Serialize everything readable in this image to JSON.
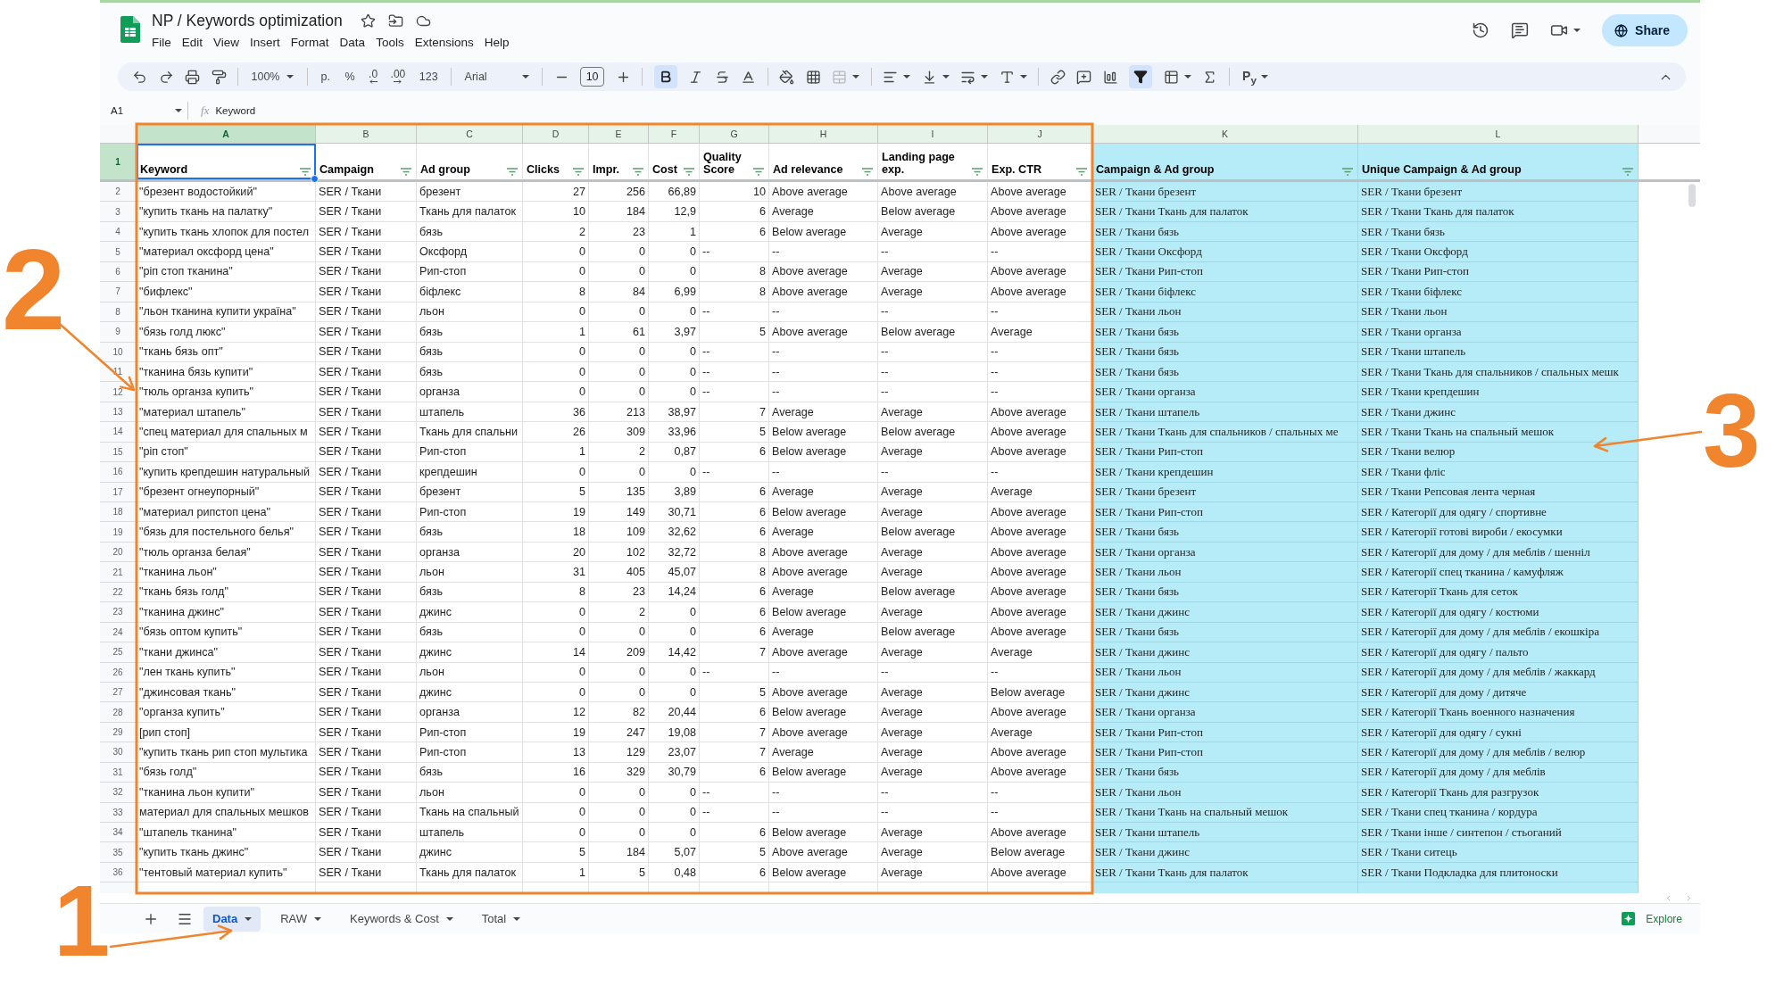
{
  "document": {
    "title": "NP / Keywords optimization",
    "menu": [
      "File",
      "Edit",
      "View",
      "Insert",
      "Format",
      "Data",
      "Tools",
      "Extensions",
      "Help"
    ],
    "share": "Share"
  },
  "toolbar": {
    "zoom": "100%",
    "currency": "р.",
    "percent": "%",
    "decimals_less": ".0",
    "decimals_more": ".00",
    "number_format": "123",
    "font": "Arial",
    "font_size": "10",
    "bold_on": true,
    "merge_disabled": true,
    "filter_on": true,
    "input_tools": "P$_{y}$"
  },
  "formula_bar": {
    "cell": "A1",
    "fx": "fx",
    "content": "Keyword"
  },
  "columns": [
    {
      "letter": "A",
      "header": "Keyword",
      "selected": true,
      "highlighted": false
    },
    {
      "letter": "B",
      "header": "Campaign",
      "selected": false,
      "highlighted": false
    },
    {
      "letter": "C",
      "header": "Ad group",
      "selected": false,
      "highlighted": false
    },
    {
      "letter": "D",
      "header": "Clicks",
      "selected": false,
      "highlighted": false
    },
    {
      "letter": "E",
      "header": "Impr.",
      "selected": false,
      "highlighted": false
    },
    {
      "letter": "F",
      "header": "Cost",
      "selected": false,
      "highlighted": false
    },
    {
      "letter": "G",
      "header": "Quality Score",
      "selected": false,
      "highlighted": false
    },
    {
      "letter": "H",
      "header": "Ad relevance",
      "selected": false,
      "highlighted": false
    },
    {
      "letter": "I",
      "header": "Landing page exp.",
      "selected": false,
      "highlighted": false
    },
    {
      "letter": "J",
      "header": "Exp. CTR",
      "selected": false,
      "highlighted": false
    },
    {
      "letter": "K",
      "header": "Campaign & Ad group",
      "selected": false,
      "highlighted": true
    },
    {
      "letter": "L",
      "header": "Unique Campaign & Ad group",
      "selected": false,
      "highlighted": true
    }
  ],
  "header_row": {
    "number": "1",
    "selected": true
  },
  "rows": [
    {
      "number": "2",
      "cells": [
        "\"брезент водостойкий\"",
        "SER / Ткани",
        "брезент",
        "27",
        "256",
        "66,89",
        "10",
        "Above average",
        "Above average",
        "Above average",
        "SER / Ткани брезент",
        "SER / Ткани брезент"
      ]
    },
    {
      "number": "3",
      "cells": [
        "\"купить ткань на палатку\"",
        "SER / Ткани",
        "Ткань для палаток",
        "10",
        "184",
        "12,9",
        "6",
        "Average",
        "Below average",
        "Above average",
        "SER / Ткани Ткань для палаток",
        "SER / Ткани Ткань для палаток"
      ]
    },
    {
      "number": "4",
      "cells": [
        "\"купить ткань хлопок для постел",
        "SER / Ткани",
        "бязь",
        "2",
        "23",
        "1",
        "6",
        "Below average",
        "Average",
        "Above average",
        "SER / Ткани бязь",
        "SER / Ткани бязь"
      ]
    },
    {
      "number": "5",
      "cells": [
        "\"материал оксфорд цена\"",
        "SER / Ткани",
        "Оксфорд",
        "0",
        "0",
        "0",
        "--",
        "--",
        "--",
        "--",
        "SER / Ткани Оксфорд",
        "SER / Ткани Оксфорд"
      ]
    },
    {
      "number": "6",
      "cells": [
        "\"ріп стоп тканина\"",
        "SER / Ткани",
        "Рип-стоп",
        "0",
        "0",
        "0",
        "8",
        "Above average",
        "Average",
        "Above average",
        "SER / Ткани Рип-стоп",
        "SER / Ткани Рип-стоп"
      ]
    },
    {
      "number": "7",
      "cells": [
        "\"бифлекс\"",
        "SER / Ткани",
        "біфлекс",
        "8",
        "84",
        "6,99",
        "8",
        "Above average",
        "Average",
        "Above average",
        "SER / Ткани біфлекс",
        "SER / Ткани біфлекс"
      ]
    },
    {
      "number": "8",
      "cells": [
        "\"льон тканина купити україна\"",
        "SER / Ткани",
        "льон",
        "0",
        "0",
        "0",
        "--",
        "--",
        "--",
        "--",
        "SER / Ткани льон",
        "SER / Ткани льон"
      ]
    },
    {
      "number": "9",
      "cells": [
        "\"бязь голд люкс\"",
        "SER / Ткани",
        "бязь",
        "1",
        "61",
        "3,97",
        "5",
        "Above average",
        "Below average",
        "Average",
        "SER / Ткани бязь",
        "SER / Ткани органза"
      ]
    },
    {
      "number": "10",
      "cells": [
        "\"ткань бязь опт\"",
        "SER / Ткани",
        "бязь",
        "0",
        "0",
        "0",
        "--",
        "--",
        "--",
        "--",
        "SER / Ткани бязь",
        "SER / Ткани штапель"
      ]
    },
    {
      "number": "11",
      "cells": [
        "\"тканина бязь купити\"",
        "SER / Ткани",
        "бязь",
        "0",
        "0",
        "0",
        "--",
        "--",
        "--",
        "--",
        "SER / Ткани бязь",
        "SER / Ткани Ткань для спальников / спальных мешк"
      ]
    },
    {
      "number": "12",
      "cells": [
        "\"тюль органза купить\"",
        "SER / Ткани",
        "органза",
        "0",
        "0",
        "0",
        "--",
        "--",
        "--",
        "--",
        "SER / Ткани органза",
        "SER / Ткани крепдешин"
      ]
    },
    {
      "number": "13",
      "cells": [
        "\"материал штапель\"",
        "SER / Ткани",
        "штапель",
        "36",
        "213",
        "38,97",
        "7",
        "Average",
        "Average",
        "Above average",
        "SER / Ткани штапель",
        "SER / Ткани джинс"
      ]
    },
    {
      "number": "14",
      "cells": [
        "\"спец материал для спальных м",
        "SER / Ткани",
        "Ткань для спальни",
        "26",
        "309",
        "33,96",
        "5",
        "Below average",
        "Below average",
        "Above average",
        "SER / Ткани Ткань для спальников / спальных ме",
        "SER / Ткани Ткань на спальный мешок"
      ]
    },
    {
      "number": "15",
      "cells": [
        "\"ріп стоп\"",
        "SER / Ткани",
        "Рип-стоп",
        "1",
        "2",
        "0,87",
        "6",
        "Below average",
        "Average",
        "Above average",
        "SER / Ткани Рип-стоп",
        "SER / Ткани велюр"
      ]
    },
    {
      "number": "16",
      "cells": [
        "\"купить крепдешин натуральный",
        "SER / Ткани",
        "крепдешин",
        "0",
        "0",
        "0",
        "--",
        "--",
        "--",
        "--",
        "SER / Ткани крепдешин",
        "SER / Ткани фліс"
      ]
    },
    {
      "number": "17",
      "cells": [
        "\"брезент огнеупорный\"",
        "SER / Ткани",
        "брезент",
        "5",
        "135",
        "3,89",
        "6",
        "Average",
        "Average",
        "Average",
        "SER / Ткани брезент",
        "SER / Ткани Репсовая лента черная"
      ]
    },
    {
      "number": "18",
      "cells": [
        "\"материал рипстоп цена\"",
        "SER / Ткани",
        "Рип-стоп",
        "19",
        "149",
        "30,71",
        "6",
        "Below average",
        "Average",
        "Above average",
        "SER / Ткани Рип-стоп",
        "SER / Категорії для одягу / спортивне"
      ]
    },
    {
      "number": "19",
      "cells": [
        "\"бязь для постельного белья\"",
        "SER / Ткани",
        "бязь",
        "18",
        "109",
        "32,62",
        "6",
        "Average",
        "Below average",
        "Above average",
        "SER / Ткани бязь",
        "SER / Категорії готові вироби / екосумки"
      ]
    },
    {
      "number": "20",
      "cells": [
        "\"тюль органза белая\"",
        "SER / Ткани",
        "органза",
        "20",
        "102",
        "32,72",
        "8",
        "Above average",
        "Average",
        "Above average",
        "SER / Ткани органза",
        "SER / Категорії для дому / для меблів / шенніл"
      ]
    },
    {
      "number": "21",
      "cells": [
        "\"тканина льон\"",
        "SER / Ткани",
        "льон",
        "31",
        "405",
        "45,07",
        "8",
        "Above average",
        "Average",
        "Above average",
        "SER / Ткани льон",
        "SER / Категорії спец тканина / камуфляж"
      ]
    },
    {
      "number": "22",
      "cells": [
        "\"ткань бязь голд\"",
        "SER / Ткани",
        "бязь",
        "8",
        "23",
        "14,24",
        "6",
        "Average",
        "Below average",
        "Above average",
        "SER / Ткани бязь",
        "SER / Категорії Ткань для сеток"
      ]
    },
    {
      "number": "23",
      "cells": [
        "\"тканина джинс\"",
        "SER / Ткани",
        "джинс",
        "0",
        "2",
        "0",
        "6",
        "Below average",
        "Average",
        "Above average",
        "SER / Ткани джинс",
        "SER / Категорії для одягу / костюми"
      ]
    },
    {
      "number": "24",
      "cells": [
        "\"бязь оптом купить\"",
        "SER / Ткани",
        "бязь",
        "0",
        "0",
        "0",
        "6",
        "Average",
        "Below average",
        "Above average",
        "SER / Ткани бязь",
        "SER / Категорії для дому / для меблів / екошкіра"
      ]
    },
    {
      "number": "25",
      "cells": [
        "\"ткани джинса\"",
        "SER / Ткани",
        "джинс",
        "14",
        "209",
        "14,42",
        "7",
        "Above average",
        "Average",
        "Average",
        "SER / Ткани джинс",
        "SER / Категорії для одягу / пальто"
      ]
    },
    {
      "number": "26",
      "cells": [
        "\"лен ткань купить\"",
        "SER / Ткани",
        "льон",
        "0",
        "0",
        "0",
        "--",
        "--",
        "--",
        "--",
        "SER / Ткани льон",
        "SER / Категорії для дому / для меблів / жаккард"
      ]
    },
    {
      "number": "27",
      "cells": [
        "\"джинсовая ткань\"",
        "SER / Ткани",
        "джинс",
        "0",
        "0",
        "0",
        "5",
        "Above average",
        "Average",
        "Below average",
        "SER / Ткани джинс",
        "SER / Категорії для дому / дитяче"
      ]
    },
    {
      "number": "28",
      "cells": [
        "\"органза купить\"",
        "SER / Ткани",
        "органза",
        "12",
        "82",
        "20,44",
        "6",
        "Below average",
        "Average",
        "Above average",
        "SER / Ткани органза",
        "SER / Категорії Ткань военного назначения"
      ]
    },
    {
      "number": "29",
      "cells": [
        "[рип стоп]",
        "SER / Ткани",
        "Рип-стоп",
        "19",
        "247",
        "19,08",
        "7",
        "Above average",
        "Average",
        "Average",
        "SER / Ткани Рип-стоп",
        "SER / Категорії для одягу / сукні"
      ]
    },
    {
      "number": "30",
      "cells": [
        "\"купить ткань рип стоп мультика",
        "SER / Ткани",
        "Рип-стоп",
        "13",
        "129",
        "23,07",
        "7",
        "Average",
        "Average",
        "Above average",
        "SER / Ткани Рип-стоп",
        "SER / Категорії для дому / для меблів / велюр"
      ]
    },
    {
      "number": "31",
      "cells": [
        "\"бязь голд\"",
        "SER / Ткани",
        "бязь",
        "16",
        "329",
        "30,79",
        "6",
        "Below average",
        "Average",
        "Above average",
        "SER / Ткани бязь",
        "SER / Категорії для дому / для меблів"
      ]
    },
    {
      "number": "32",
      "cells": [
        "\"тканина льон купити\"",
        "SER / Ткани",
        "льон",
        "0",
        "0",
        "0",
        "--",
        "--",
        "--",
        "--",
        "SER / Ткани льон",
        "SER / Категорії Ткань для разгрузок"
      ]
    },
    {
      "number": "33",
      "cells": [
        "материал для спальных мешков",
        "SER / Ткани",
        "Ткань на спальный",
        "0",
        "0",
        "0",
        "--",
        "--",
        "--",
        "--",
        "SER / Ткани Ткань на спальный мешок",
        "SER / Ткани спец тканина / кордура"
      ]
    },
    {
      "number": "34",
      "cells": [
        "\"штапель тканина\"",
        "SER / Ткани",
        "штапель",
        "0",
        "0",
        "0",
        "6",
        "Below average",
        "Average",
        "Above average",
        "SER / Ткани штапель",
        "SER / Ткани інше / синтепон / стьоганий"
      ]
    },
    {
      "number": "35",
      "cells": [
        "\"купить ткань джинс\"",
        "SER / Ткани",
        "джинс",
        "5",
        "184",
        "5,07",
        "5",
        "Above average",
        "Average",
        "Below average",
        "SER / Ткани джинс",
        "SER / Ткани ситець"
      ]
    },
    {
      "number": "36",
      "cells": [
        "\"тентовый материал купить\"",
        "SER / Ткани",
        "Ткань для палаток",
        "1",
        "5",
        "0,48",
        "6",
        "Below average",
        "Average",
        "Above average",
        "SER / Ткани Ткань для палаток",
        "SER / Ткани Подкладка для плитоноски"
      ]
    }
  ],
  "sheet_tabs": [
    {
      "label": "Data",
      "selected": true
    },
    {
      "label": "RAW",
      "selected": false
    },
    {
      "label": "Keywords & Cost",
      "selected": false
    },
    {
      "label": "Total",
      "selected": false
    }
  ],
  "explore": "Explore",
  "annotations": [
    {
      "label": "2"
    },
    {
      "label": "3"
    },
    {
      "label": "1"
    }
  ]
}
